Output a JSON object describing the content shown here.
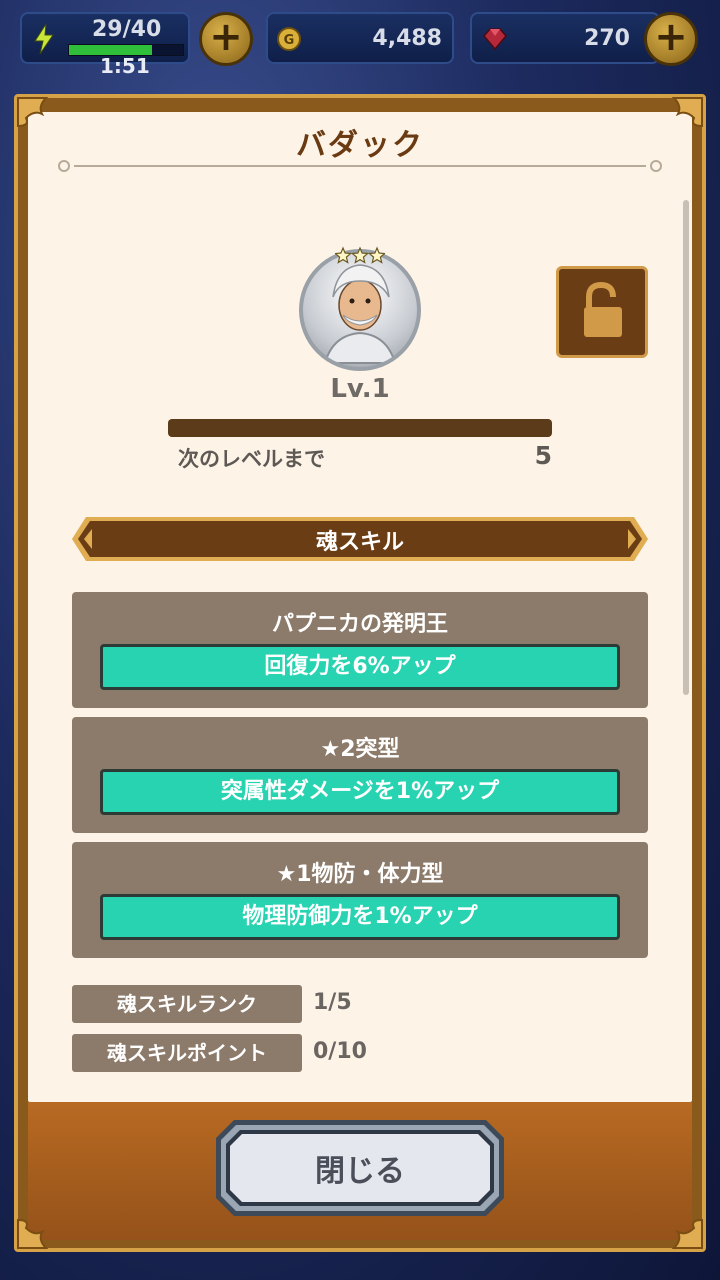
{
  "status_bar": {
    "stamina_value": "29/40",
    "stamina_timer": "1:51",
    "stamina_fill": 0.73,
    "gold_value": "4,488",
    "gem_value": "270"
  },
  "dialog": {
    "title": "バダック",
    "level": "Lv.1",
    "next_level_label": "次のレベルまで",
    "next_level_value": "5",
    "section_title": "魂スキル",
    "skills": [
      {
        "name": "パプニカの発明王",
        "effect": "回復力を6%アップ"
      },
      {
        "name": "★2突型",
        "effect": "突属性ダメージを1%アップ"
      },
      {
        "name": "★1物防・体力型",
        "effect": "物理防御力を1%アップ"
      }
    ],
    "stats": [
      {
        "label": "魂スキルランク",
        "value": "1/5"
      },
      {
        "label": "魂スキルポイント",
        "value": "0/10"
      }
    ],
    "close_label": "閉じる",
    "rarity_stars": 3
  },
  "colors": {
    "accent_gold": "#d6a248",
    "skill_green": "#27d3b1",
    "panel_brown": "#8a5a1c",
    "skill_box": "#8c7b6b"
  }
}
